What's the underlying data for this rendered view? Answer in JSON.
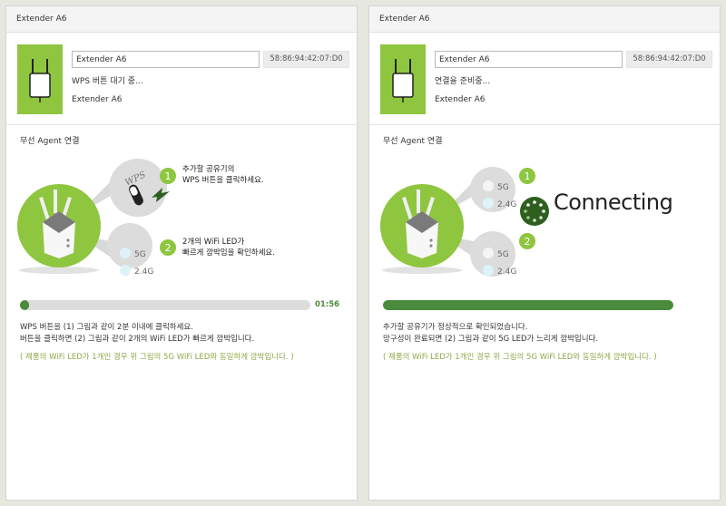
{
  "panels": [
    {
      "title": "Extender A6",
      "name_value": "Extender A6",
      "mac": "58:86:94:42:07:D0",
      "status": "WPS 버튼 대기 중...",
      "device_name": "Extender A6",
      "section_label": "무선 Agent 연결",
      "step1_badge": "1",
      "step1_text": [
        "추가할 공유기의",
        "WPS 버튼을 클릭하세요."
      ],
      "step2_badge": "2",
      "step2_text": [
        "2개의 WiFi LED가",
        "빠르게 깜박임을 확인하세요."
      ],
      "wps_label": "WPS",
      "led_5g": "5G",
      "led_24g": "2.4G",
      "progress": 0.03,
      "timer": "01:56",
      "desc": [
        "WPS 버튼을 (1) 그림과 같이 2분 이내에 클릭하세요.",
        "버튼을 클릭하면 (2) 그림과 같이 2개의 WiFi LED가 빠르게 깜박입니다."
      ],
      "note": "( 제품의 WiFi LED가 1개인 경우 위 그림의 5G WiFi LED와 동일하게 깜박입니다. )"
    },
    {
      "title": "Extender A6",
      "name_value": "Extender A6",
      "mac": "58:86:94:42:07:D0",
      "status": "연결을 준비중...",
      "device_name": "Extender A6",
      "section_label": "무선 Agent 연결",
      "step1_badge": "1",
      "step2_badge": "2",
      "led_5g": "5G",
      "led_24g": "2.4G",
      "connecting": "Connecting",
      "progress": 1.0,
      "desc": [
        "추가할 공유기가 정상적으로 확인되었습니다.",
        "망구성이 완료되면 (2) 그림과 같이 5G LED가 느리게 깜박입니다."
      ],
      "note": "( 제품의 WiFi LED가 1개인 경우 위 그림의 5G WiFi LED와 동일하게 깜박입니다. )"
    }
  ],
  "colors": {
    "accent": "#8ec63f",
    "progress": "#4a8a3c",
    "note": "#8ba948"
  }
}
